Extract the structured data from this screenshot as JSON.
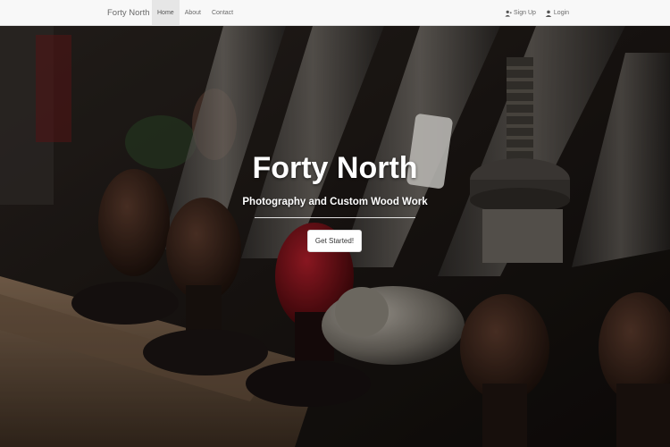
{
  "navbar": {
    "brand": "Forty North",
    "links": [
      {
        "label": "Home",
        "active": true
      },
      {
        "label": "About",
        "active": false
      },
      {
        "label": "Contact",
        "active": false
      }
    ],
    "signup_label": "Sign Up",
    "login_label": "Login"
  },
  "hero": {
    "title": "Forty North",
    "subtitle": "Photography and Custom Wood Work",
    "cta_label": "Get Started!"
  }
}
